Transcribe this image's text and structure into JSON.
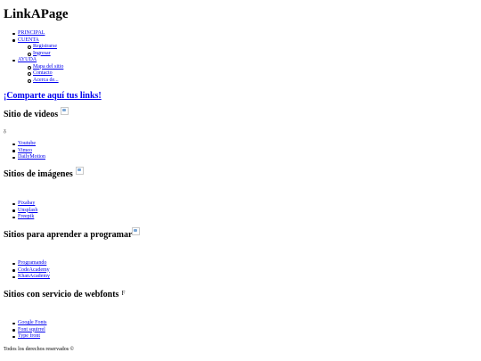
{
  "site": {
    "title": "LinkAPage"
  },
  "nav": {
    "principal": "PRINCIPAL",
    "cuenta": "CUENTA",
    "cuenta_items": [
      "Registrarse",
      "Ingresar"
    ],
    "ayuda": "AYUDA",
    "ayuda_items": [
      "Mapa del sitio",
      "Contacto",
      "Acerca de..."
    ]
  },
  "share_link": "¡Comparte aquí tus links!",
  "sections": {
    "videos": {
      "title": "Sitio de videos",
      "icon": "broken-image-icon",
      "links": [
        "Youtube",
        "Vimeo",
        "DailyMotion"
      ]
    },
    "images": {
      "title": "Sitios de imágenes",
      "icon": "broken-image-icon",
      "links": [
        "Pixabay",
        "Unsplash",
        "Freepik"
      ]
    },
    "programming": {
      "title": "Sitios para aprender a programar",
      "icon": "broken-image-icon",
      "links": [
        "Programando",
        "CodeAcademy",
        "KhanAcademy"
      ]
    },
    "webfonts": {
      "title": "Sitios con servicio de webfonts",
      "glyph": "F",
      "links": [
        "Google Fonts",
        "Font squirrel",
        "Type front"
      ]
    }
  },
  "video_glyph": "ᵹ",
  "footer": "Todos los derechos reservados ©"
}
